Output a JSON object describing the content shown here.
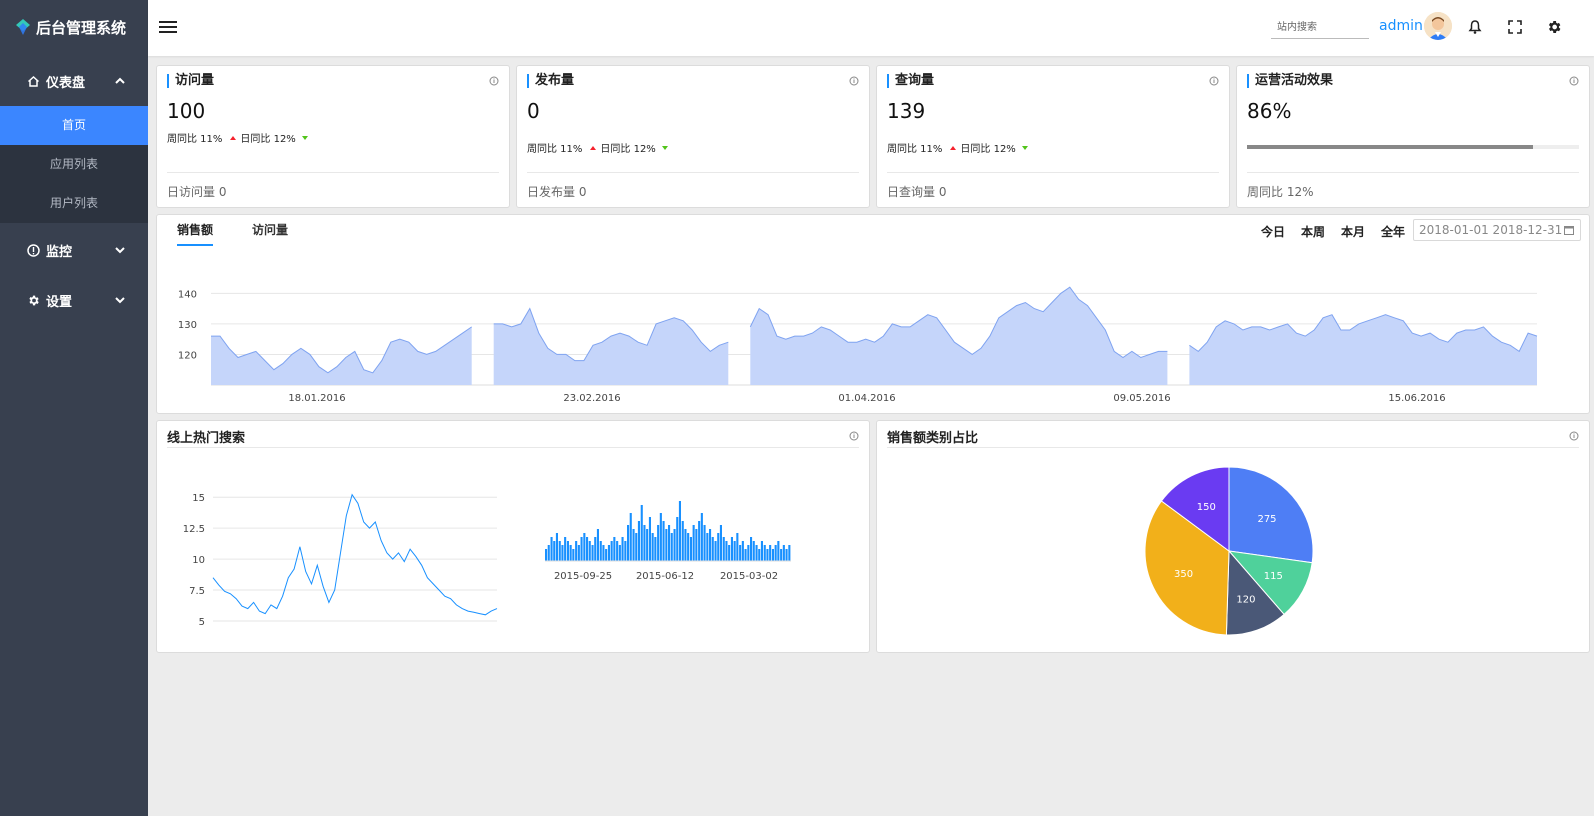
{
  "app": {
    "title": "后台管理系统"
  },
  "sidebar": {
    "groups": [
      {
        "label": "仪表盘",
        "icon": "home-icon",
        "expanded": true,
        "items": [
          {
            "label": "首页",
            "active": true
          },
          {
            "label": "应用列表"
          },
          {
            "label": "用户列表"
          }
        ]
      },
      {
        "label": "监控",
        "icon": "info-circle-icon",
        "expanded": false
      },
      {
        "label": "设置",
        "icon": "gear-icon",
        "expanded": false
      }
    ]
  },
  "header": {
    "search_placeholder": "站内搜索",
    "user": "admin",
    "icons": [
      "menu-icon",
      "bell-icon",
      "fullscreen-icon",
      "gear-icon"
    ]
  },
  "stats": [
    {
      "title": "访问量",
      "value": "100",
      "week_label": "周同比 11%",
      "day_label": "日同比 12%",
      "footer": "日访问量 0"
    },
    {
      "title": "发布量",
      "value": "0",
      "week_label": "周同比 11%",
      "day_label": "日同比 12%",
      "footer": "日发布量 0"
    },
    {
      "title": "查询量",
      "value": "139",
      "week_label": "周同比 11%",
      "day_label": "日同比 12%",
      "footer": "日查询量 0"
    },
    {
      "title": "运营活动效果",
      "value": "86%",
      "progress": 0.86,
      "footer": "周同比 12%"
    }
  ],
  "sales": {
    "tabs": [
      "销售额",
      "访问量"
    ],
    "active_tab": 0,
    "ranges": [
      "今日",
      "本周",
      "本月",
      "全年"
    ],
    "date_range": "2018-01-01 2018-12-31",
    "colors": {
      "area": "#c5d5fa",
      "line": "#7fa3f0",
      "accent": "#1890ff"
    }
  },
  "hot_search": {
    "title": "线上热门搜索"
  },
  "category": {
    "title": "销售额类别占比"
  },
  "chart_data": [
    {
      "type": "area",
      "title": "",
      "x_ticks": [
        "18.01.2016",
        "23.02.2016",
        "01.04.2016",
        "09.05.2016",
        "15.06.2016"
      ],
      "y_ticks": [
        120,
        130,
        140
      ],
      "ylim": [
        110,
        146
      ],
      "grid": true,
      "segments": [
        [
          126,
          126,
          122,
          119,
          120,
          121,
          118,
          115,
          117,
          120,
          122,
          120,
          116,
          114,
          116,
          119,
          121,
          115,
          114,
          118,
          124,
          125,
          124,
          121,
          120,
          121,
          123,
          125,
          127,
          129
        ],
        [
          130,
          130,
          129,
          130,
          135,
          127,
          122,
          120,
          120,
          118,
          118,
          123,
          124,
          126,
          127,
          126,
          124,
          123,
          130,
          131,
          132,
          131,
          128,
          124,
          121,
          123,
          124
        ],
        [
          129,
          135,
          133,
          126,
          125,
          126,
          126,
          127,
          129,
          128,
          126,
          124,
          124,
          125,
          124,
          126,
          130,
          129,
          129,
          131,
          133,
          132,
          128,
          124,
          122,
          120,
          122,
          126,
          132,
          134,
          136,
          137,
          135,
          134,
          137,
          140,
          142,
          138,
          136,
          132,
          128,
          121,
          119,
          121,
          119,
          120,
          121,
          121
        ],
        [
          123,
          121,
          124,
          129,
          131,
          130,
          128,
          129,
          129,
          128,
          129,
          130,
          127,
          126,
          128,
          132,
          133,
          128,
          128,
          130,
          131,
          132,
          133,
          132,
          131,
          127,
          126,
          127,
          125,
          124,
          127,
          128,
          128,
          129,
          126,
          124,
          123,
          121,
          127,
          126
        ]
      ]
    },
    {
      "type": "line",
      "title": "",
      "y_ticks": [
        "5",
        "7.5",
        "10",
        "12.5",
        "15"
      ],
      "ylim": [
        5,
        15.5
      ],
      "grid": true,
      "values": [
        8.5,
        7.9,
        7.4,
        7.2,
        6.8,
        6.2,
        6.0,
        6.5,
        5.8,
        5.6,
        6.3,
        6.0,
        7.0,
        8.5,
        9.2,
        11.0,
        9.0,
        8.0,
        9.5,
        7.8,
        6.5,
        7.5,
        10.5,
        13.5,
        15.2,
        14.5,
        13.0,
        12.5,
        13.0,
        11.5,
        10.5,
        10.0,
        10.5,
        9.8,
        10.8,
        10.2,
        9.5,
        8.5,
        8.0,
        7.5,
        7.0,
        6.8,
        6.3,
        6.0,
        5.8,
        5.7,
        5.6,
        5.5,
        5.8,
        6.0
      ]
    },
    {
      "type": "bar",
      "title": "",
      "x_ticks": [
        "2015-09-25",
        "2015-06-12",
        "2015-03-02"
      ],
      "values": [
        3,
        4,
        6,
        5,
        7,
        5,
        4,
        6,
        5,
        4,
        3,
        5,
        4,
        6,
        7,
        6,
        5,
        4,
        6,
        8,
        5,
        4,
        3,
        4,
        5,
        6,
        5,
        4,
        6,
        5,
        9,
        12,
        8,
        7,
        10,
        14,
        9,
        8,
        11,
        7,
        6,
        9,
        12,
        10,
        8,
        9,
        7,
        8,
        11,
        15,
        10,
        8,
        7,
        6,
        9,
        8,
        10,
        12,
        9,
        7,
        8,
        6,
        5,
        7,
        9,
        6,
        5,
        4,
        6,
        5,
        7,
        4,
        5,
        3,
        4,
        6,
        5,
        4,
        3,
        5,
        4,
        3,
        4,
        3,
        4,
        5,
        3,
        4,
        3,
        4
      ]
    },
    {
      "type": "pie",
      "title": "",
      "slices": [
        {
          "value": 275,
          "color": "#4e7ef5"
        },
        {
          "value": 115,
          "color": "#4fd19b"
        },
        {
          "value": 120,
          "color": "#4a5877"
        },
        {
          "value": 350,
          "color": "#f2b01a"
        },
        {
          "value": 150,
          "color": "#6a3bf2"
        }
      ]
    }
  ]
}
